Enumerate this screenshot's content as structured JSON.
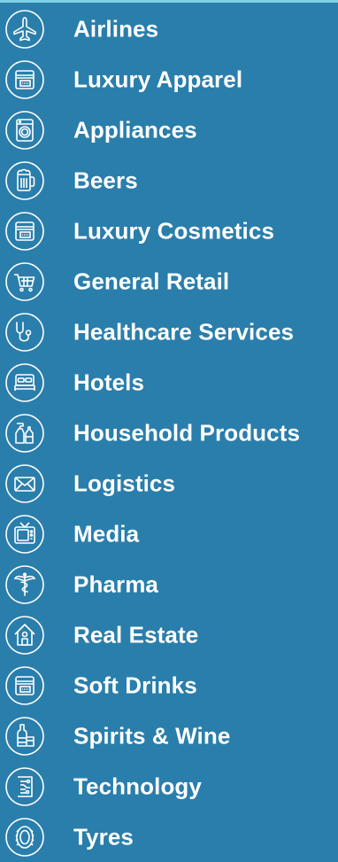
{
  "menu": {
    "items": [
      {
        "label": "Airlines",
        "icon": "airplane-icon"
      },
      {
        "label": "Luxury Apparel",
        "icon": "card-icon"
      },
      {
        "label": "Appliances",
        "icon": "washing-machine-icon"
      },
      {
        "label": "Beers",
        "icon": "beer-mug-icon"
      },
      {
        "label": "Luxury Cosmetics",
        "icon": "card-icon"
      },
      {
        "label": "General Retail",
        "icon": "shopping-cart-icon"
      },
      {
        "label": "Healthcare Services",
        "icon": "stethoscope-icon"
      },
      {
        "label": "Hotels",
        "icon": "bed-icon"
      },
      {
        "label": "Household Products",
        "icon": "spray-bottle-icon"
      },
      {
        "label": "Logistics",
        "icon": "envelope-icon"
      },
      {
        "label": "Media",
        "icon": "tv-icon"
      },
      {
        "label": "Pharma",
        "icon": "caduceus-icon"
      },
      {
        "label": "Real Estate",
        "icon": "house-icon"
      },
      {
        "label": "Soft Drinks",
        "icon": "card-icon"
      },
      {
        "label": "Spirits & Wine",
        "icon": "bottle-glass-icon"
      },
      {
        "label": "Technology",
        "icon": "circuit-icon"
      },
      {
        "label": "Tyres",
        "icon": "tyre-icon"
      }
    ]
  },
  "colors": {
    "background": "#2a7eab",
    "top_strip": "#7fd0e6",
    "text": "#ffffff"
  }
}
